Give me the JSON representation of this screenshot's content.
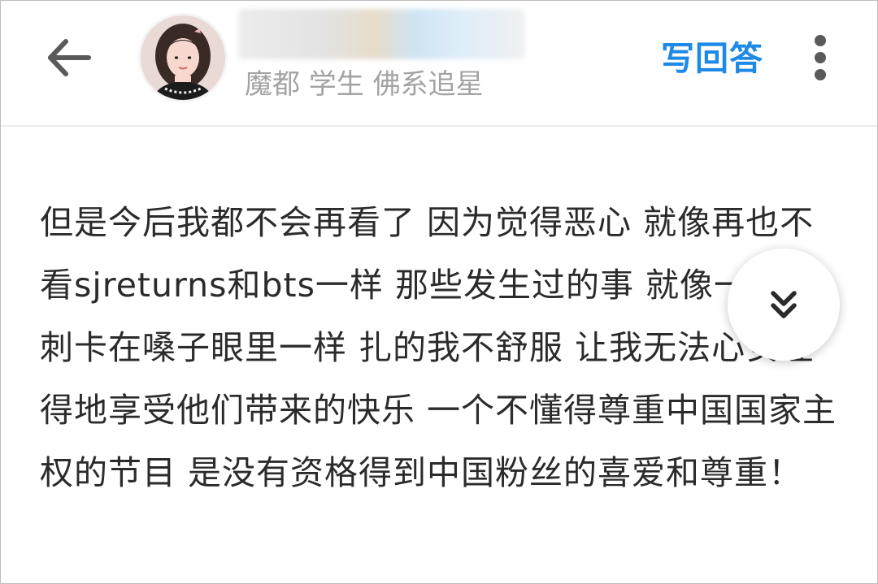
{
  "header": {
    "back_icon": "back-arrow-icon",
    "avatar_icon": "user-avatar",
    "user_tags": "魔都 学生 佛系追星",
    "write_answer_label": "写回答",
    "more_icon": "more-vertical-icon"
  },
  "answer": {
    "text": "但是今后我都不会再看了 因为觉得恶心 就像再也不看sjreturns和bts一样 那些发生过的事 就像一根鱼刺卡在嗓子眼里一样 扎的我不舒服 让我无法心安理得地享受他们带来的快乐 一个不懂得尊重中国国家主权的节目 是没有资格得到中国粉丝的喜爱和尊重！"
  },
  "floating": {
    "scroll_icon": "double-chevron-down-icon"
  },
  "colors": {
    "accent": "#1e8ae6",
    "text": "#2b2b2b",
    "muted": "#a3a3a3",
    "icon": "#5a5a5a"
  }
}
